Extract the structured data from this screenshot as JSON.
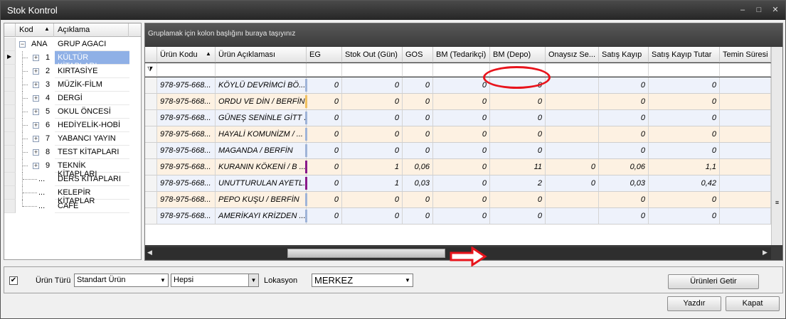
{
  "window": {
    "title": "Stok Kontrol",
    "minimize": "–",
    "maximize": "□",
    "close": "✕"
  },
  "tree": {
    "col_kod": "Kod",
    "col_aciklama": "Açıklama",
    "sort_glyph": "▲",
    "root": {
      "code": "ANA",
      "label": "GRUP AGACI"
    },
    "items": [
      {
        "code": "1",
        "label": "KÜLTÜR KİTAPLARI",
        "expandable": true
      },
      {
        "code": "2",
        "label": "KIRTASİYE",
        "expandable": true
      },
      {
        "code": "3",
        "label": "MÜZİK-FİLM",
        "expandable": true
      },
      {
        "code": "4",
        "label": "DERGİ",
        "expandable": true
      },
      {
        "code": "5",
        "label": "OKUL ÖNCESİ",
        "expandable": true
      },
      {
        "code": "6",
        "label": "HEDİYELİK-HOBİ",
        "expandable": true
      },
      {
        "code": "7",
        "label": "YABANCI YAYIN",
        "expandable": true
      },
      {
        "code": "8",
        "label": "TEST KİTAPLARI",
        "expandable": true
      },
      {
        "code": "9",
        "label": "TEKNİK KİTAPLARI",
        "expandable": true
      },
      {
        "code": "...",
        "label": "DERS KİTAPLARI",
        "expandable": false
      },
      {
        "code": "...",
        "label": "KELEPİR KİTAPLAR",
        "expandable": false
      },
      {
        "code": "...",
        "label": "CAFE",
        "expandable": false
      }
    ]
  },
  "grid": {
    "group_hint": "Gruplamak için kolon başlığını buraya taşıyınız",
    "filter_icon": "⧩",
    "columns": [
      "Ürün Kodu",
      "Ürün Açıklaması",
      "EG",
      "Stok Out (Gün)",
      "GOS",
      "BM (Tedarikçi)",
      "BM (Depo)",
      "Onaysız Se...",
      "Satış Kayıp",
      "Satış Kayıp Tutar",
      "Temin Süresi"
    ],
    "rows": [
      [
        "978-975-668...",
        "KÖYLÜ DEVRİMCİ BÖ...",
        "0",
        "0",
        "0",
        "0",
        "0",
        "",
        "0",
        "0",
        ""
      ],
      [
        "978-975-668...",
        "ORDU VE DİN / BERFİN",
        "0",
        "0",
        "0",
        "0",
        "0",
        "",
        "0",
        "0",
        ""
      ],
      [
        "978-975-668...",
        "GÜNEŞ SENİNLE GİTT ...",
        "0",
        "0",
        "0",
        "0",
        "0",
        "",
        "0",
        "0",
        ""
      ],
      [
        "978-975-668...",
        "HAYALİ KOMUNİZM / ...",
        "0",
        "0",
        "0",
        "0",
        "0",
        "",
        "0",
        "0",
        ""
      ],
      [
        "978-975-668...",
        "MAGANDA / BERFİN",
        "0",
        "0",
        "0",
        "0",
        "0",
        "",
        "0",
        "0",
        ""
      ],
      [
        "978-975-668...",
        "KURANIN KÖKENİ / B ...",
        "0",
        "1",
        "0,06",
        "0",
        "11",
        "0",
        "0,06",
        "1,1",
        ""
      ],
      [
        "978-975-668...",
        "UNUTTURULAN AYETL...",
        "0",
        "1",
        "0,03",
        "0",
        "2",
        "0",
        "0,03",
        "0,42",
        ""
      ],
      [
        "978-975-668...",
        "PEPO KUŞU / BERFİN",
        "0",
        "0",
        "0",
        "0",
        "0",
        "",
        "0",
        "0",
        ""
      ],
      [
        "978-975-668...",
        "AMERİKAYI KRİZDEN ...",
        "0",
        "0",
        "0",
        "0",
        "0",
        "",
        "0",
        "0",
        ""
      ]
    ],
    "row_markers": [
      "#9fb4d8",
      "#f0c060",
      "#9fb4d8",
      "#9fb4d8",
      "#9fb4d8",
      "#8a1a8a",
      "#8a1a8a",
      "#9fb4d8",
      "#9fb4d8"
    ],
    "scroll_left": "◀",
    "scroll_right": "▶"
  },
  "filters": {
    "checked": "✔",
    "urun_turu_label": "Ürün Türü",
    "urun_turu_value": "Standart Ürün",
    "second_value": "Hepsi",
    "lokasyon_label": "Lokasyon",
    "lokasyon_value": "MERKEZ",
    "dropdown_glyph": "▼"
  },
  "buttons": {
    "getir": "Ürünleri Getir",
    "yazdir": "Yazdır",
    "kapat": "Kapat"
  },
  "colors": {
    "highlight_red": "#e8141c",
    "selection_blue": "#8fb0e6",
    "row_alt": "#fdf1e2",
    "row_blue": "#eef2fb"
  }
}
